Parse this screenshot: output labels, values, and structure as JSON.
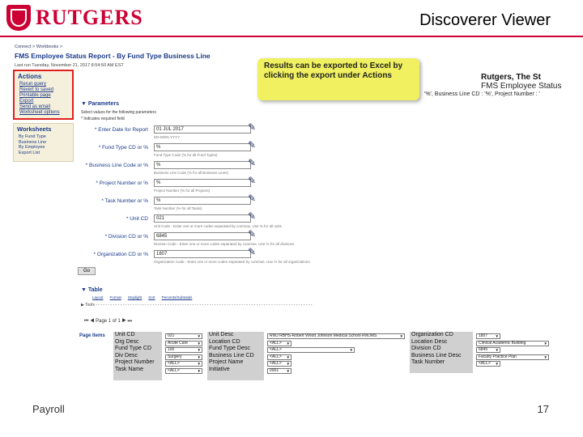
{
  "header": {
    "logo_text": "RUTGERS",
    "viewer_title": "Discoverer Viewer"
  },
  "report": {
    "breadcrumb": "Connect  >  Workbooks  >",
    "title": "FMS Employee Status Report - By Fund Type Business Line",
    "last_run": "Last run Tuesday, November 21, 2017 8:54:50 AM EST",
    "company": "Rutgers, The St",
    "status_title": "FMS Employee Status",
    "params_line": "'%', Business Line CD : '%', Project Number : '"
  },
  "actions": {
    "heading": "Actions",
    "items": [
      "Rerun query",
      "Revert to saved",
      "Printable page",
      "Export",
      "Send as email",
      "Worksheet options"
    ]
  },
  "worksheets": {
    "heading": "Worksheets",
    "items": [
      "By Fund Type",
      "Business Line",
      "By Employee",
      "Export List"
    ]
  },
  "callout": {
    "text": "Results can be exported to Excel by clicking the export under Actions"
  },
  "parameters": {
    "heading": "Parameters",
    "sub1": "Select values for the following parameters",
    "sub2": "* Indicates required field",
    "fields": [
      {
        "label": "* Enter Date for Report",
        "value": "01 JUL 2017",
        "hint": "DD-MON-YYYY"
      },
      {
        "label": "* Fund Type CD or %",
        "value": "%",
        "hint": "Fund Type Code (% for all Fund Types)"
      },
      {
        "label": "* Business Line Code or %",
        "value": "%",
        "hint": "Business Line Code (% for all Business Lines)"
      },
      {
        "label": "* Project Number or %",
        "value": "%",
        "hint": "Project Number (% for all Projects)"
      },
      {
        "label": "* Task Number or %",
        "value": "%",
        "hint": "Task Number (% for all Tasks)"
      },
      {
        "label": "* Unit CD",
        "value": "021",
        "hint": "Unit Code - Enter one or more codes separated by commas. Use % for all units"
      },
      {
        "label": "* Division CD or %",
        "value": "6845",
        "hint": "Division Code - Enter one or more codes separated by commas. Use % for all divisions"
      },
      {
        "label": "* Organization CD or %",
        "value": "1807",
        "hint": "Organization Code - Enter one or more codes separated by commas. Use % for all organizations"
      }
    ],
    "go_label": "Go"
  },
  "table": {
    "heading": "Table",
    "links": [
      "Layout",
      "Format",
      "Stoplight",
      "Sort",
      "Percents/Subtotals"
    ],
    "tools_label": "Tools",
    "tools_row": "Tools  - - - - - - - - - - - - - - - - - - - - - - - - - - - - - - - - - - - - - - - - - - - - - - - - - - - - - - - - - - - - - - - - - - - - - - - - - - - - - - - - - - - - - - - -",
    "pager": "Page 1 of 1"
  },
  "page_items": {
    "label": "Page Items",
    "col1": {
      "labels": [
        "Unit CD",
        "Org Desc",
        "Fund Type CD",
        "Div Desc",
        "Project Number",
        "Task Name"
      ],
      "values": [
        "021",
        "Acute Care",
        "100",
        "Surgery",
        "<ALL>",
        "<ALL>"
      ]
    },
    "col2": {
      "labels": [
        "Unit Desc",
        "Location CD",
        "Fund Type Desc",
        "Business Line CD",
        "Project Name",
        "Initiative"
      ],
      "values": [
        "RWJ RBHS-Robert Wood Johnson Medical School RWJMS",
        "<ALL>",
        "<ALL>",
        "<ALL>",
        "<ALL>",
        "0001"
      ]
    },
    "col3": {
      "labels": [
        "Organization CD",
        "Location Desc",
        "Division CD",
        "Business Line Desc",
        "Task Number"
      ],
      "values": [
        "1807",
        "Clinical Academic Building",
        "6845",
        "Faculty Practice Plan",
        "<ALL>"
      ]
    }
  },
  "footer": {
    "left": "Payroll",
    "page_number": "17"
  }
}
